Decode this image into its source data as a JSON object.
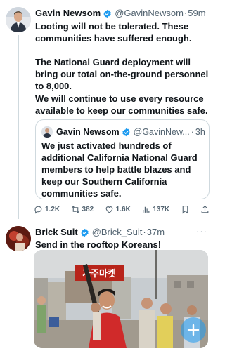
{
  "tweet1": {
    "name": "Gavin Newsom",
    "handle": "@GavinNewsom",
    "dot": "·",
    "time": "59m",
    "more": "···",
    "paragraphs": [
      "Looting will not be tolerated. These communities have suffered enough.",
      "The National Guard deployment will bring our total on-the-ground personnel to 8,000.",
      "We will continue to use every resource available to keep our communities safe."
    ]
  },
  "quote": {
    "name": "Gavin Newsom",
    "handle": "@GavinNew...",
    "dot": "·",
    "time": "3h",
    "text": "We just activated hundreds of additional California National Guard members to help battle blazes and keep our Southern California communities safe."
  },
  "actions": {
    "replies": "1.2K",
    "reposts": "382",
    "likes": "1.6K",
    "views": "137K"
  },
  "tweet2": {
    "name": "Brick Suit",
    "handle": "@Brick_Suit",
    "dot": "·",
    "time": "37m",
    "more": "···",
    "text": "Send in the rooftop Koreans!",
    "photo_sign": "가주마켓"
  },
  "colors": {
    "verified": "#1d9bf0",
    "text": "#0f1419",
    "secondary": "#536471",
    "border": "#cfd9de"
  },
  "icons": [
    "verified-badge-icon",
    "reply-icon",
    "repost-icon",
    "like-icon",
    "views-icon",
    "bookmark-icon",
    "share-icon",
    "compose-plus-icon"
  ]
}
